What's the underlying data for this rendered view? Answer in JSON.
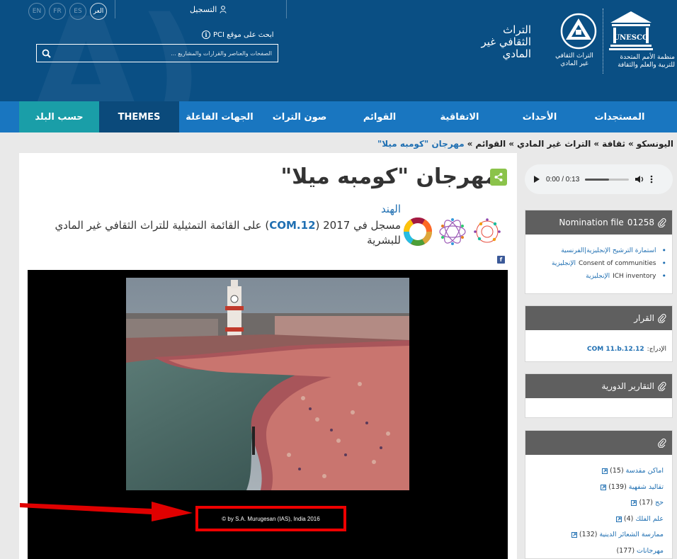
{
  "header": {
    "languages": [
      {
        "code": "EN",
        "active": false
      },
      {
        "code": "FR",
        "active": false
      },
      {
        "code": "ES",
        "active": false
      },
      {
        "code": "العر",
        "active": true
      }
    ],
    "login_label": "التسجيل",
    "pci_label": "ابحث على موقع PCI",
    "search_placeholder": "الصفحات والعناصر والقرارات والمشاريع ...",
    "ich_title": "التراث الثقافي غير المادي",
    "ich_logo_sub": "التراث الثقافي غير المادي",
    "unesco_word": "UNESCO",
    "unesco_sub": "منظمة الأمم المتحدة للتربية والعلم والثقافة"
  },
  "nav": {
    "items": [
      {
        "label": "المستجدات"
      },
      {
        "label": "الأحداث"
      },
      {
        "label": "الاتفاقية"
      },
      {
        "label": "القوائم"
      },
      {
        "label": "صون التراث"
      },
      {
        "label": "الجهات الفاعلة"
      },
      {
        "label": "THEMES"
      },
      {
        "label": "حسب البلد"
      }
    ]
  },
  "breadcrumb": {
    "items": [
      "اليونسكو",
      "ثقافة",
      "التراث غير المادي",
      "القوائم"
    ],
    "current": "مهرجان \"كومبه ميلا\"",
    "separator": "»"
  },
  "main": {
    "title": "مهرجان \"كومبه ميلا\"",
    "country": "الهند",
    "inscribed_prefix": "مسجل في 2017 (",
    "inscribed_com": "COM.12",
    "inscribed_suffix": ") على القائمة التمثيلية للتراث الثقافي غير المادي للبشرية",
    "facebook_label": "f",
    "photo_credit": "© by S.A. Murugesan (IAS), India 2016"
  },
  "audio": {
    "time": "0:00 / 0:13",
    "progress": 0.55
  },
  "nomination": {
    "title": "Nomination file",
    "number": "01258",
    "items": [
      {
        "prefix": "",
        "link": "استمارة الترشيح الإنجليزية|الفرنسية",
        "suffix": ""
      },
      {
        "prefix": "",
        "link": "الإنجليزية",
        "suffix": "Consent of communities"
      },
      {
        "prefix": "",
        "link": "الإنجليزية",
        "suffix": "ICH inventory"
      }
    ]
  },
  "decision": {
    "title": "القرار",
    "label": "الإدراج:",
    "value": "COM 11.b.12.12"
  },
  "periodic": {
    "title": "التقارير الدورية"
  },
  "keywords": {
    "items": [
      {
        "label": "اماكن مقدسة",
        "count": "(15)"
      },
      {
        "label": "تقاليد شفهية",
        "count": "(139)"
      },
      {
        "label": "حج",
        "count": "(17)"
      },
      {
        "label": "علم الفلك",
        "count": "(4)"
      },
      {
        "label": "ممارسة الشعائر الدينية",
        "count": "(132)"
      },
      {
        "label": "مهرجانات",
        "count": "(177)"
      }
    ]
  },
  "colors": {
    "header_bg": "#0a4f84",
    "nav_bg": "#1976c0",
    "nav_themes_bg": "#0b4a7b",
    "nav_country_bg": "#1a9ea8",
    "link": "#1f6fb2",
    "panel_head": "#5f5f5f",
    "highlight": "#e00000"
  }
}
